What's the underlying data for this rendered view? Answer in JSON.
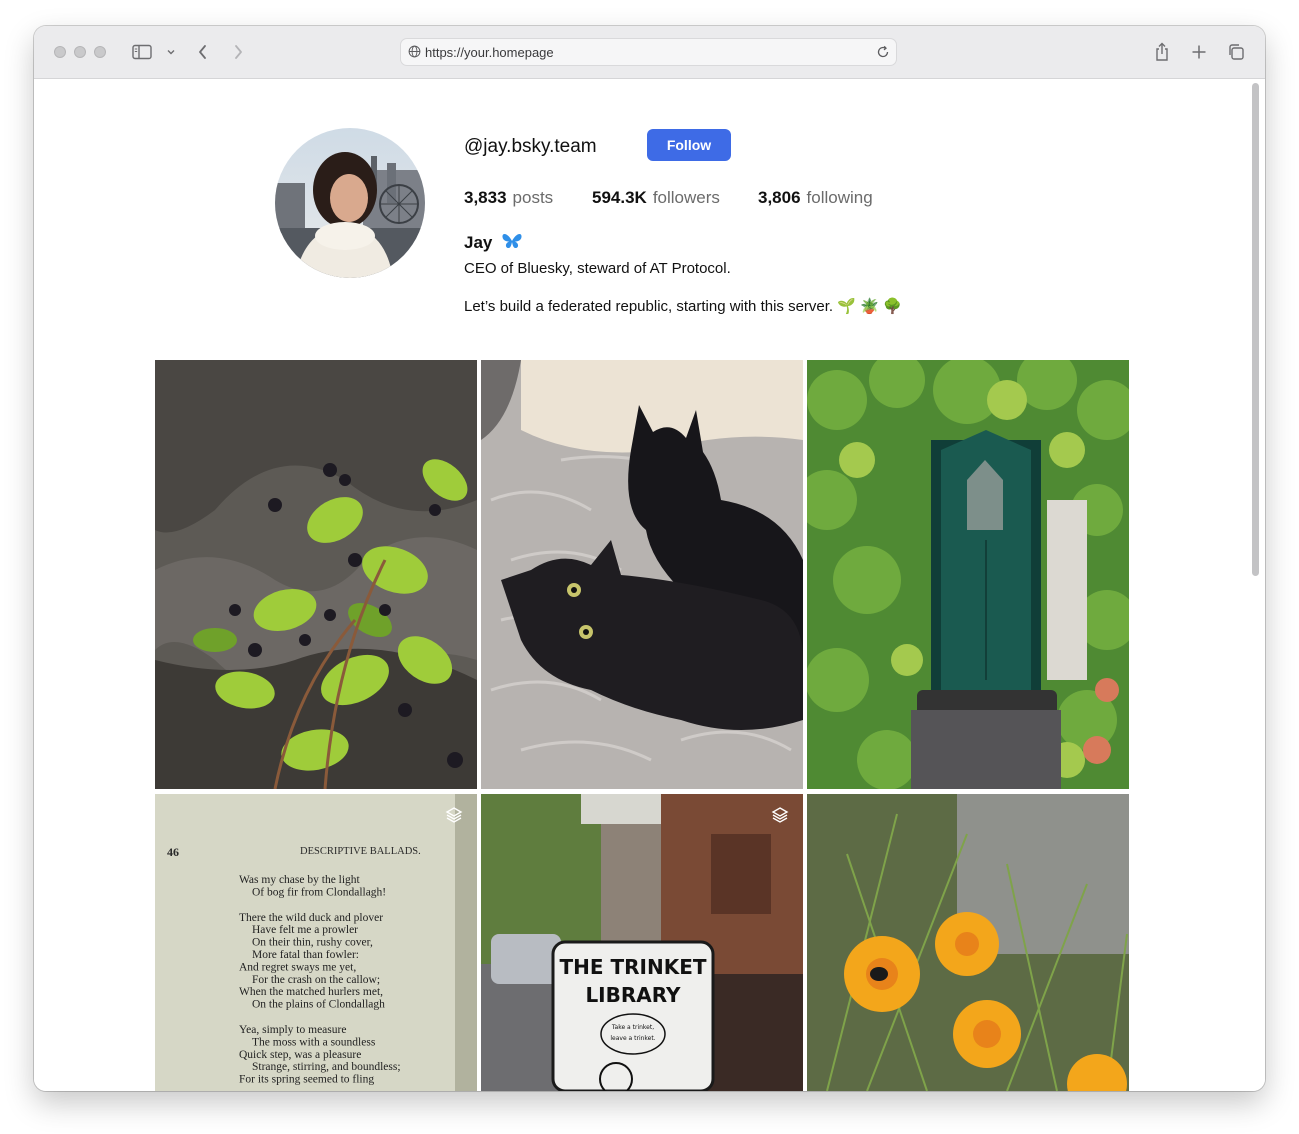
{
  "browser": {
    "url": "https://your.homepage"
  },
  "profile": {
    "handle": "@jay.bsky.team",
    "follow_label": "Follow",
    "stats": {
      "posts_count": "3,833",
      "posts_label": "posts",
      "followers_count": "594.3K",
      "followers_label": "followers",
      "following_count": "3,806",
      "following_label": "following"
    },
    "display_name": "Jay",
    "bio_line1": "CEO of Bluesky, steward of AT Protocol.",
    "bio_line2": "Let’s build a federated republic, starting with this server. 🌱 🪴 🌳"
  },
  "grid": {
    "items": [
      {
        "subject": "blackberry-bush-photo",
        "multi": false
      },
      {
        "subject": "black-kittens-photo",
        "multi": false
      },
      {
        "subject": "green-door-ivy-photo",
        "multi": false
      },
      {
        "subject": "book-page-photo",
        "multi": true,
        "page_number": "46",
        "page_heading": "DESCRIPTIVE BALLADS.",
        "poem_lines": [
          "Was my chase by the light",
          "Of bog fir from Clondallagh!",
          "",
          "There the wild duck and plover",
          "Have felt me a prowler",
          "On their thin, rushy cover,",
          "More fatal than fowler:",
          "And regret sways me yet,",
          "For the crash on the callow;",
          "When the matched hurlers met,",
          "On the plains of Clondallagh",
          "",
          "Yea, simply to measure",
          "The moss with a soundless",
          "Quick step, was a pleasure",
          "Strange, stirring, and boundless;",
          "For its spring seemed to fling"
        ]
      },
      {
        "subject": "trinket-library-photo",
        "multi": true,
        "sign_line1": "THE TRINKET",
        "sign_line2": "LIBRARY",
        "bubble_line1": "Take a trinket,",
        "bubble_line2": "leave a trinket."
      },
      {
        "subject": "poppies-photo",
        "multi": false
      }
    ]
  },
  "colors": {
    "accent": "#3e6be6",
    "toolbar_bg": "#ebebed",
    "muted_text": "#6b6b6b"
  }
}
